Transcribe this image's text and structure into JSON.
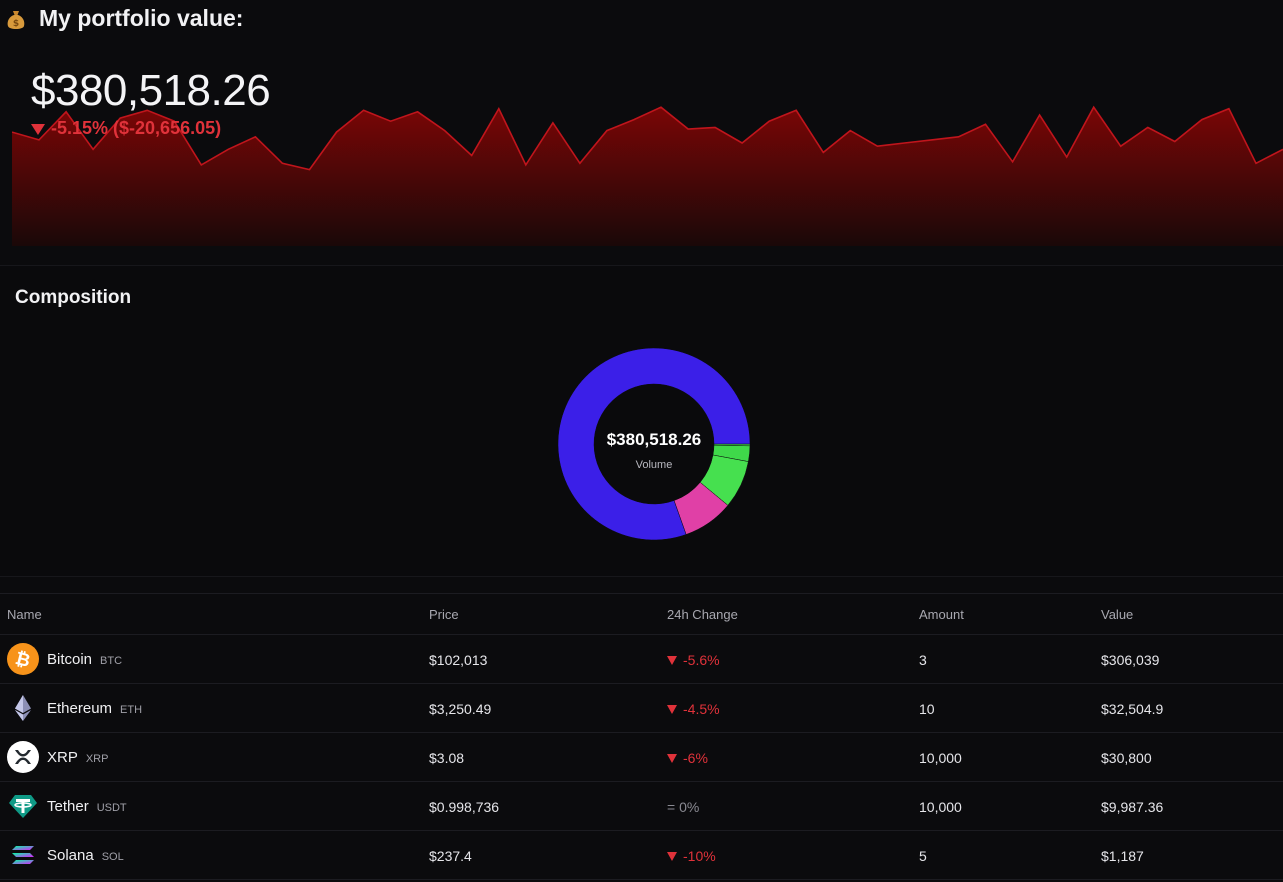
{
  "header": {
    "title": "My portfolio value:",
    "icon": "money-bag-icon"
  },
  "portfolio": {
    "value": "$380,518.26",
    "change": "-5.15% ($-20,656.05)",
    "change_color": "#e0323a"
  },
  "value_history": {
    "values": [
      73,
      68,
      86,
      62,
      82,
      87,
      80,
      52,
      62,
      70,
      53,
      49,
      73,
      87,
      80,
      86,
      74,
      58,
      88,
      52,
      79,
      53,
      74,
      81,
      89,
      75,
      76,
      66,
      80,
      87,
      60,
      74,
      64,
      66,
      68,
      70,
      78,
      54,
      84,
      57,
      89,
      64,
      76,
      67,
      81,
      88,
      53,
      62
    ],
    "fill_color": "#7a0b0b",
    "line_color": "#c0151c"
  },
  "composition": {
    "title": "Composition",
    "center_value": "$380,518.26",
    "center_label": "Volume",
    "slices": [
      {
        "name": "Bitcoin",
        "value": 306039,
        "color": "#3b1fe8"
      },
      {
        "name": "Ethereum",
        "value": 32504.9,
        "color": "#e040a6"
      },
      {
        "name": "XRP",
        "value": 30800,
        "color": "#46e04f"
      },
      {
        "name": "Tether",
        "value": 9987.36,
        "color": "#3fd84a"
      },
      {
        "name": "Solana",
        "value": 1187,
        "color": "#46e04f"
      }
    ]
  },
  "table": {
    "headers": {
      "name": "Name",
      "price": "Price",
      "change": "24h Change",
      "amount": "Amount",
      "value": "Value"
    },
    "rows": [
      {
        "name": "Bitcoin",
        "symbol": "BTC",
        "price": "$102,013",
        "change": "-5.6%",
        "direction": "down",
        "amount": "3",
        "value": "$306,039",
        "icon": "bitcoin-icon"
      },
      {
        "name": "Ethereum",
        "symbol": "ETH",
        "price": "$3,250.49",
        "change": "-4.5%",
        "direction": "down",
        "amount": "10",
        "value": "$32,504.9",
        "icon": "ethereum-icon"
      },
      {
        "name": "XRP",
        "symbol": "XRP",
        "price": "$3.08",
        "change": "-6%",
        "direction": "down",
        "amount": "10,000",
        "value": "$30,800",
        "icon": "xrp-icon"
      },
      {
        "name": "Tether",
        "symbol": "USDT",
        "price": "$0.998,736",
        "change": "= 0%",
        "direction": "flat",
        "amount": "10,000",
        "value": "$9,987.36",
        "icon": "tether-icon"
      },
      {
        "name": "Solana",
        "symbol": "SOL",
        "price": "$237.4",
        "change": "-10%",
        "direction": "down",
        "amount": "5",
        "value": "$1,187",
        "icon": "solana-icon"
      }
    ]
  }
}
